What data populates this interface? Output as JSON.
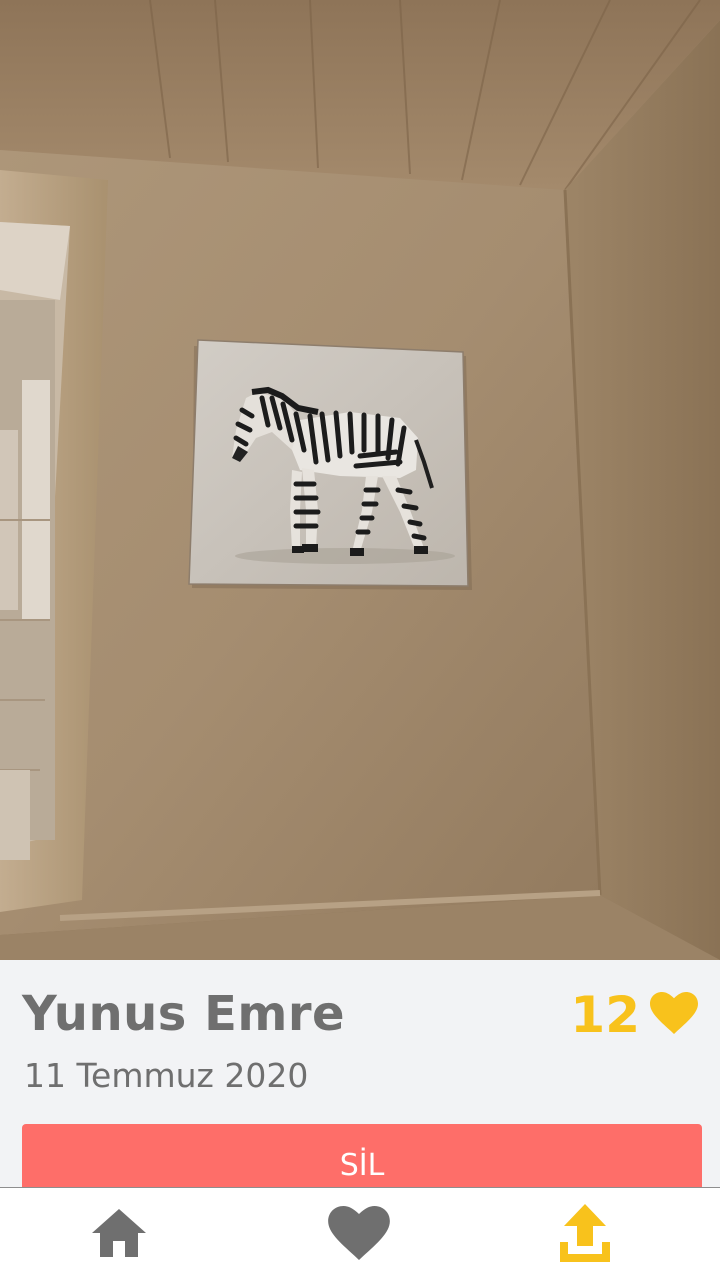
{
  "photo": {
    "description_icon": "room-photo-with-zebra-painting"
  },
  "post": {
    "author": "Yunus Emre",
    "date": "11 Temmuz 2020",
    "likes": "12"
  },
  "actions": {
    "delete_label": "SİL"
  },
  "nav": {
    "items": [
      {
        "icon": "home-icon",
        "active": false
      },
      {
        "icon": "heart-icon",
        "active": false
      },
      {
        "icon": "upload-icon",
        "active": true
      }
    ]
  },
  "colors": {
    "accent": "#f8c21c",
    "delete": "#fe6e69",
    "text": "#6f6f6f",
    "icon_inactive": "#6f6f6f",
    "panel_bg": "#f2f3f5"
  }
}
